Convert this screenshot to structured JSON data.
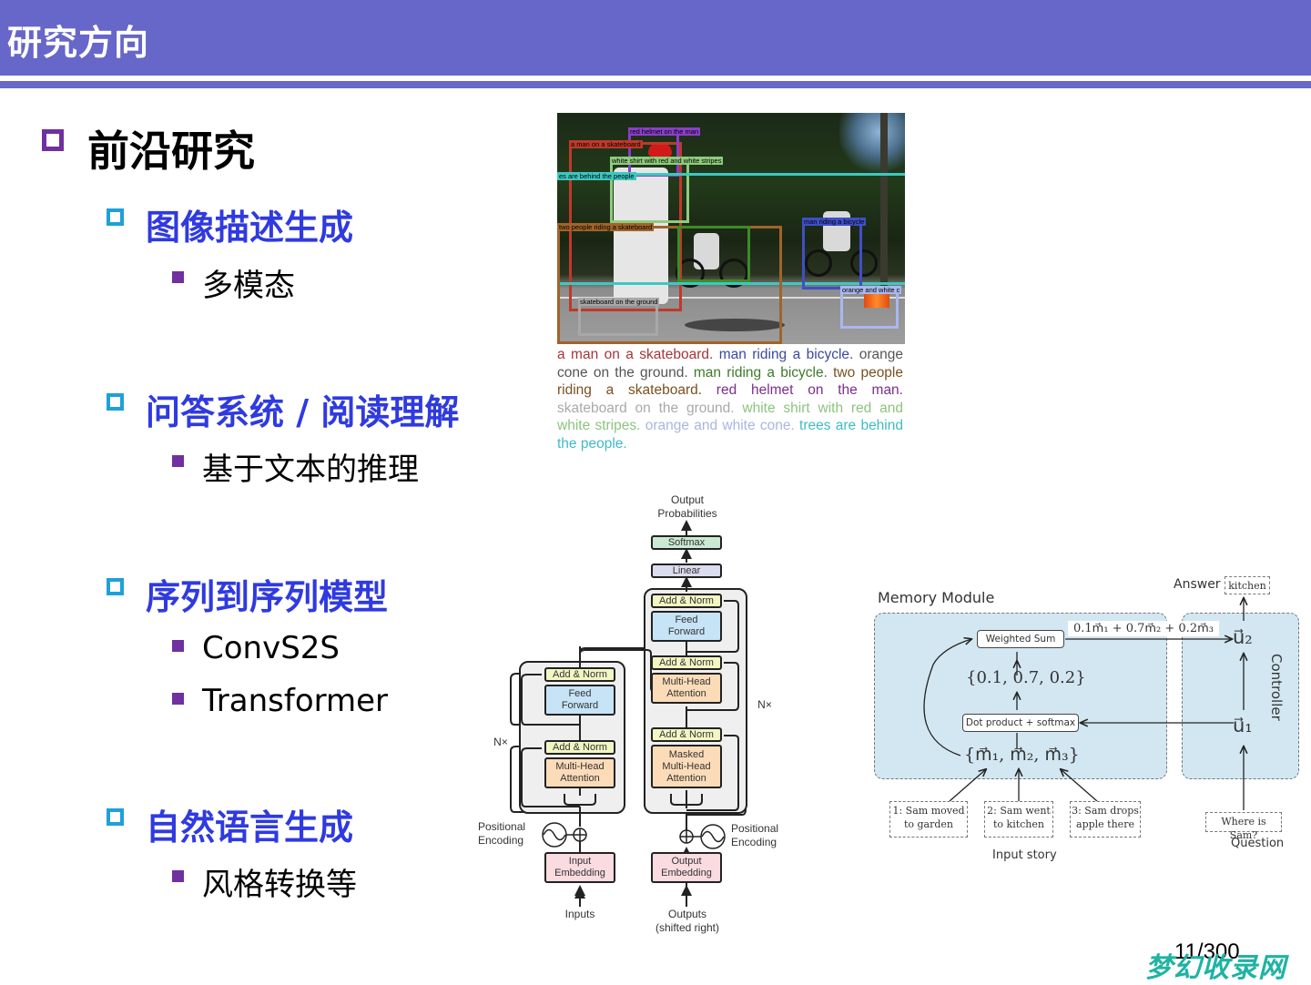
{
  "header": {
    "title": "研究方向"
  },
  "outline": {
    "level1": {
      "label": "前沿研究"
    },
    "topics": [
      {
        "label": "图像描述生成",
        "subitems": [
          "多模态"
        ]
      },
      {
        "label": "问答系统 / 阅读理解",
        "subitems": [
          "基于文本的推理"
        ]
      },
      {
        "label": "序列到序列模型",
        "subitems": [
          "ConvS2S",
          "Transformer"
        ]
      },
      {
        "label": "自然语言生成",
        "subitems": [
          "风格转换等"
        ]
      }
    ]
  },
  "colors": {
    "header": "#6766c9",
    "level1_bullet": "#7030a0",
    "level2_bullet": "#1ea0d8",
    "level2_text": "#2f3ae0",
    "level3_bullet": "#7030a0"
  },
  "dense_caption_figure": {
    "box_labels": [
      {
        "text": "red helmet on the man",
        "color": "#8a3ec9"
      },
      {
        "text": "a man on a skateboard",
        "color": "#c0392b"
      },
      {
        "text": "white shirt with red and white stripes",
        "color": "#8fcc7d"
      },
      {
        "text": "es are behind the people",
        "color": "#3cc8c0"
      },
      {
        "text": "two people riding a skateboard",
        "color": "#a0642a"
      },
      {
        "text": "man riding a bicycle",
        "color": "#3f4fc8"
      },
      {
        "text": "orange and white c",
        "color": "#a9b8ee"
      },
      {
        "text": "skateboard on the ground",
        "color": "#a8a8a8"
      }
    ],
    "caption": [
      {
        "text": "a man on a skateboard.",
        "color": "#a3353a"
      },
      {
        "text": "man riding a bicycle.",
        "color": "#3a4a9a"
      },
      {
        "text": "orange cone on the ground.",
        "color": "#555555"
      },
      {
        "text": "man riding a bicycle.",
        "color": "#3e7a2a"
      },
      {
        "text": "two people riding a skateboard.",
        "color": "#7a5020"
      },
      {
        "text": "red helmet on the man.",
        "color": "#7a2f8a"
      },
      {
        "text": "skateboard on the ground.",
        "color": "#a9a9a9"
      },
      {
        "text": "white shirt with red and white stripes.",
        "color": "#8cc47e"
      },
      {
        "text": "orange and white cone.",
        "color": "#a8b6e0"
      },
      {
        "text": "trees are behind the people.",
        "color": "#3dbcc4"
      }
    ]
  },
  "transformer_figure": {
    "output_label": "Output\nProbabilities",
    "softmax": "Softmax",
    "linear": "Linear",
    "add_norm": "Add & Norm",
    "feed_forward": "Feed\nForward",
    "multi_head": "Multi-Head\nAttention",
    "masked_multi_head": "Masked\nMulti-Head\nAttention",
    "nx": "N×",
    "positional_encoding": "Positional\nEncoding",
    "input_embedding": "Input\nEmbedding",
    "output_embedding": "Output\nEmbedding",
    "inputs": "Inputs",
    "outputs": "Outputs\n(shifted right)"
  },
  "memory_network_figure": {
    "memory_module": "Memory Module",
    "controller": "Controller",
    "answer_label": "Answer",
    "answer_value": "kitchen",
    "weighted_sum": "Weighted Sum",
    "weighted_formula": "0.1m⃗₁ + 0.7m⃗₂ + 0.2m⃗₃",
    "weights": "{0.1, 0.7, 0.2}",
    "dot_product": "Dot product + softmax",
    "memories": "{m⃗₁, m⃗₂, m⃗₃}",
    "u1": "u⃗₁",
    "u2": "u⃗₂",
    "story": [
      "1: Sam moved\nto garden",
      "2: Sam went\nto kitchen",
      "3: Sam drops\napple there"
    ],
    "story_label": "Input story",
    "question": "Where is Sam?",
    "question_label": "Question"
  },
  "footer": {
    "page_number": "11/300",
    "watermark": "梦幻收录网"
  }
}
